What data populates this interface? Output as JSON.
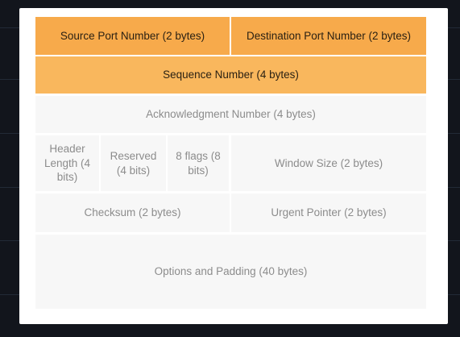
{
  "colors": {
    "primary_field": "#f7aa4b",
    "secondary_field": "#f9b75d",
    "plain_field": "#f7f7f7",
    "background": "#12151c"
  },
  "header_fields": {
    "source_port": "Source Port Number (2 bytes)",
    "destination_port": "Destination Port Number (2 bytes)",
    "sequence_number": "Sequence Number (4 bytes)",
    "acknowledgment_number": "Acknowledgment Number (4 bytes)",
    "header_length": "Header Length (4 bits)",
    "reserved": "Reserved (4 bits)",
    "flags": "8 flags (8 bits)",
    "window_size": "Window Size (2 bytes)",
    "checksum": "Checksum (2 bytes)",
    "urgent_pointer": "Urgent Pointer (2 bytes)",
    "options_padding": "Options and Padding (40 bytes)"
  }
}
